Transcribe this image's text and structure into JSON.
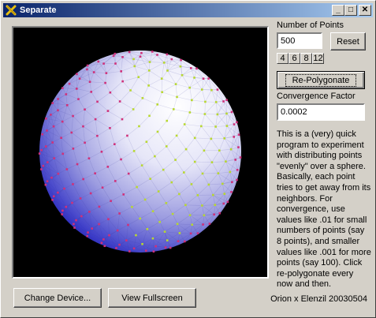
{
  "window": {
    "title": "Separate"
  },
  "titlebar": {
    "minimize": "_",
    "maximize": "□",
    "close": "✕"
  },
  "panel": {
    "num_points_label": "Number of Points",
    "num_points_value": "500",
    "reset_label": "Reset",
    "presets": [
      "4",
      "6",
      "8",
      "12"
    ],
    "repolygonate_label": "Re-Polygonate",
    "convergence_label": "Convergence Factor",
    "convergence_value": "0.0002",
    "description": "This is a (very) quick program to experiment with distributing points \"evenly\" over a sphere. Basically, each point tries to get away from its neighbors. For convergence, use values like .01 for small numbers of points (say 8 points), and smaller values like .001 for more points (say 100). Click re-polygonate every now and then."
  },
  "footer": {
    "change_device_label": "Change Device...",
    "view_fullscreen_label": "View Fullscreen",
    "credit": "Orion x Elenzil 20030504"
  },
  "icons": {
    "app": "x-logo-icon"
  }
}
